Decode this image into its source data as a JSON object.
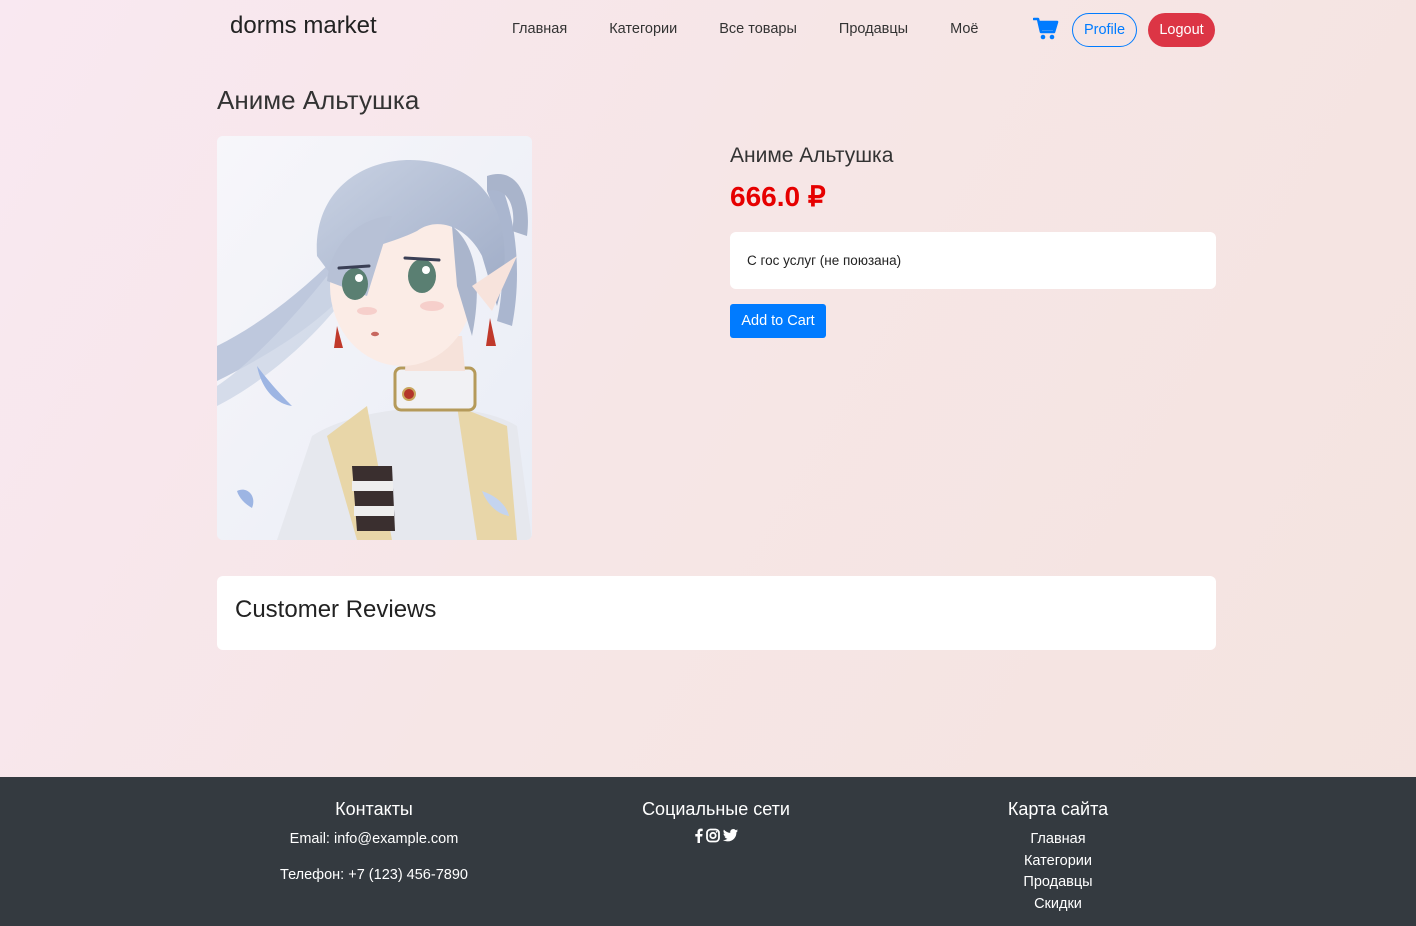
{
  "navbar": {
    "brand": "dorms market",
    "links": [
      "Главная",
      "Категории",
      "Все товары",
      "Продавцы",
      "Моё"
    ],
    "cart_icon": "shopping-cart-icon",
    "profile_label": "Profile",
    "logout_label": "Logout"
  },
  "product": {
    "page_title": "Аниме Альтушка",
    "name": "Аниме Альтушка",
    "price": "666.0 ₽",
    "description": "С гос услуг (не поюзана)",
    "add_to_cart_label": "Add to Cart",
    "image_subject": "anime-girl-illustration"
  },
  "reviews": {
    "title": "Customer Reviews"
  },
  "footer": {
    "contacts": {
      "title": "Контакты",
      "email": "Email: info@example.com",
      "phone": "Телефон: +7 (123) 456-7890"
    },
    "social": {
      "title": "Социальные сети",
      "icons": [
        "facebook-icon",
        "instagram-icon",
        "twitter-icon"
      ]
    },
    "sitemap": {
      "title": "Карта сайта",
      "links": [
        "Главная",
        "Категории",
        "Продавцы",
        "Скидки"
      ]
    }
  },
  "colors": {
    "primary": "#007bff",
    "danger": "#dc3545",
    "price": "#e60000",
    "footer_bg": "#343a40"
  }
}
